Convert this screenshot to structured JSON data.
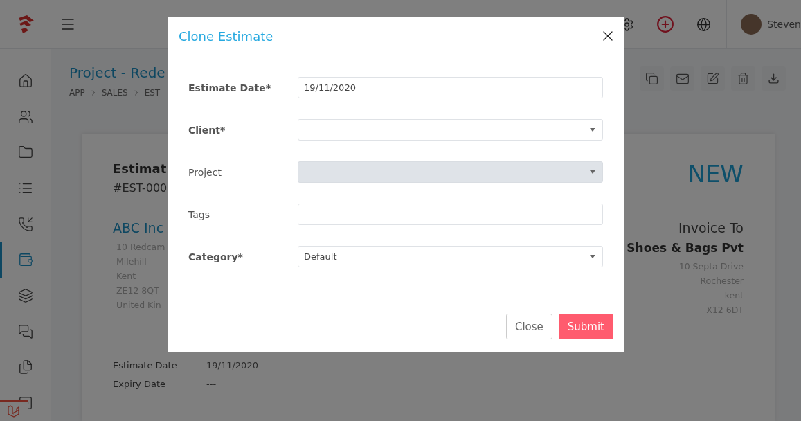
{
  "topbar": {
    "user_name": "Steven"
  },
  "sidebar": {
    "items": [
      {
        "selected": false
      },
      {
        "selected": false
      },
      {
        "selected": false
      },
      {
        "selected": false
      },
      {
        "selected": false
      },
      {
        "selected": true
      },
      {
        "selected": false
      },
      {
        "selected": false
      },
      {
        "selected": false
      },
      {
        "selected": false
      }
    ]
  },
  "page": {
    "title": "Project - Rede",
    "breadcrumb": [
      "APP",
      "SALES",
      "EST"
    ]
  },
  "estimate": {
    "heading": "Estimat",
    "number": "#EST-000",
    "status": "NEW",
    "from": {
      "name": "ABC Inc",
      "address": [
        "10 Redcam",
        "Milehill",
        "Kent",
        "ZE12 8QT",
        "United Kin"
      ]
    },
    "to": {
      "heading": "Invoice To",
      "name": "Shoes & Bags Pvt",
      "address": [
        "10 Septa Drive",
        "Rochester",
        "kent",
        "X12 6DT"
      ]
    },
    "dates": [
      {
        "label": "Estimate Date",
        "value": "19/11/2020"
      },
      {
        "label": "Expiry Date",
        "value": "---"
      }
    ]
  },
  "modal": {
    "title": "Clone Estimate",
    "fields": [
      {
        "label": "Estimate Date*",
        "kind": "text",
        "required": true,
        "disabled": false,
        "value": "19/11/2020"
      },
      {
        "label": "Client*",
        "kind": "select",
        "required": true,
        "disabled": false
      },
      {
        "label": "Project",
        "kind": "select",
        "required": false,
        "disabled": true
      },
      {
        "label": "Tags",
        "kind": "text",
        "required": false,
        "disabled": false
      },
      {
        "label": "Category*",
        "kind": "select",
        "required": true,
        "disabled": false,
        "value": "Default"
      }
    ],
    "buttons": [
      {
        "label": "Close",
        "kind": "secondary"
      },
      {
        "label": "Submit",
        "kind": "primary"
      }
    ]
  }
}
